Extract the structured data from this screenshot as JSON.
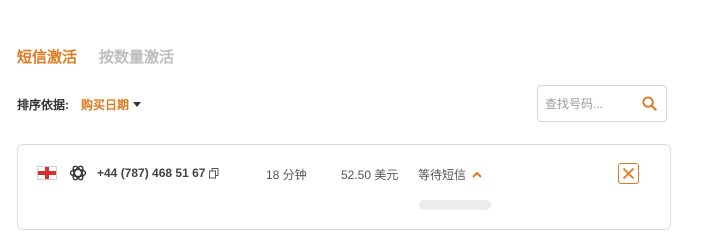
{
  "tabs": [
    {
      "label": "短信激活",
      "active": true
    },
    {
      "label": "按数量激活",
      "active": false
    }
  ],
  "sort": {
    "label": "排序依据:",
    "value": "购买日期"
  },
  "search": {
    "placeholder": "查找号码..."
  },
  "order": {
    "flag": "england-flag",
    "service_icon": "openai-icon",
    "phone": "+44 (787) 468 51 67",
    "duration": "18 分钟",
    "price": "52.50 美元",
    "status": "等待短信"
  },
  "colors": {
    "accent": "#e07a1f",
    "inactive_tab": "#bdbdbd",
    "border": "#dcdcdc"
  }
}
